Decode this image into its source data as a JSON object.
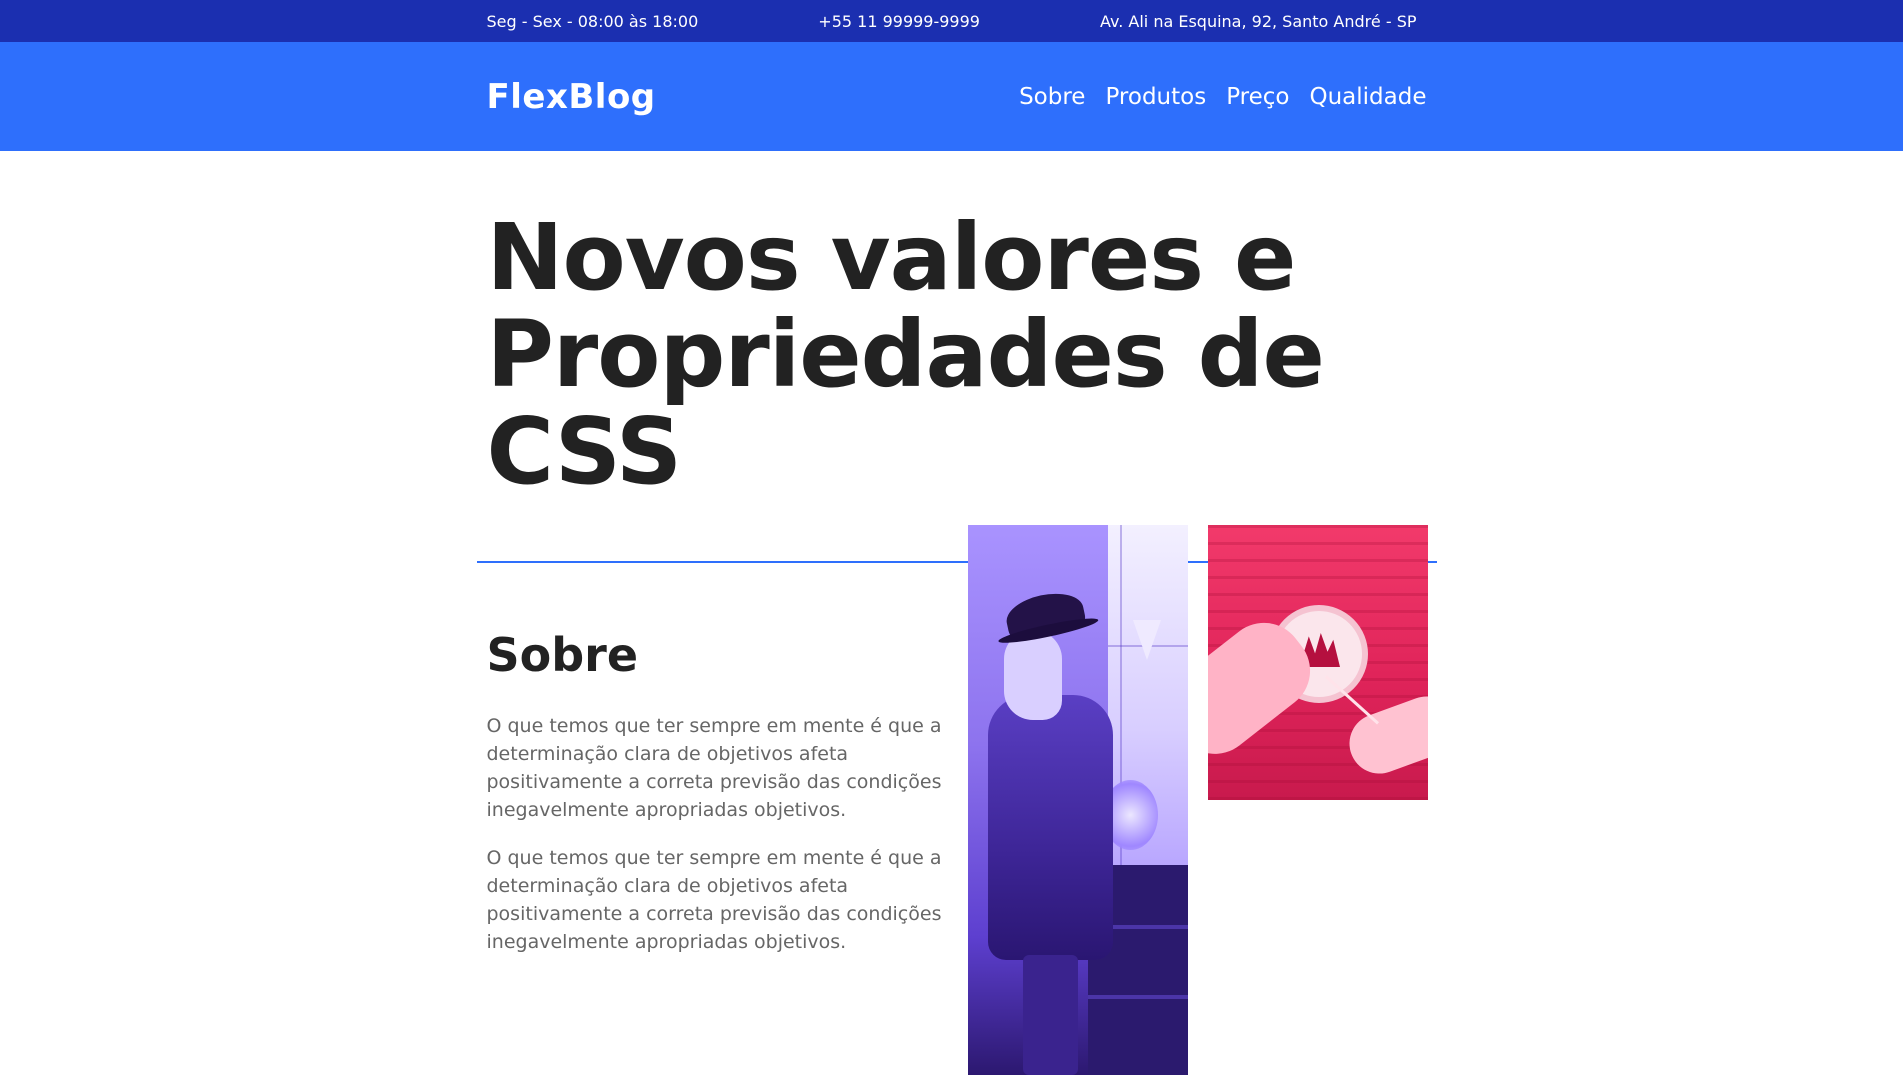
{
  "topbar": {
    "hours": "Seg - Sex - 08:00 às 18:00",
    "phone": "+55 11 99999-9999",
    "address": "Av. Ali na Esquina, 92, Santo André - SP"
  },
  "header": {
    "logo": "FlexBlog",
    "nav": [
      "Sobre",
      "Produtos",
      "Preço",
      "Qualidade"
    ]
  },
  "hero": {
    "title_line1": "Novos valores e",
    "title_line2": "Propriedades de CSS"
  },
  "about": {
    "heading": "Sobre",
    "paragraphs": [
      "O que temos que ter sempre em mente é que a determinação clara de objetivos afeta positivamente a correta previsão das condições inegavelmente apropriadas objetivos.",
      "O que temos que ter sempre em mente é que a determinação clara de objetivos afeta positivamente a correta previsão das condições inegavelmente apropriadas objetivos."
    ]
  },
  "colors": {
    "topbar": "#1b2fb0",
    "header": "#2e6ffc",
    "divider": "#2e6ffc",
    "photo1_tint": "#7b5cff",
    "photo2_tint": "#e5275c"
  }
}
